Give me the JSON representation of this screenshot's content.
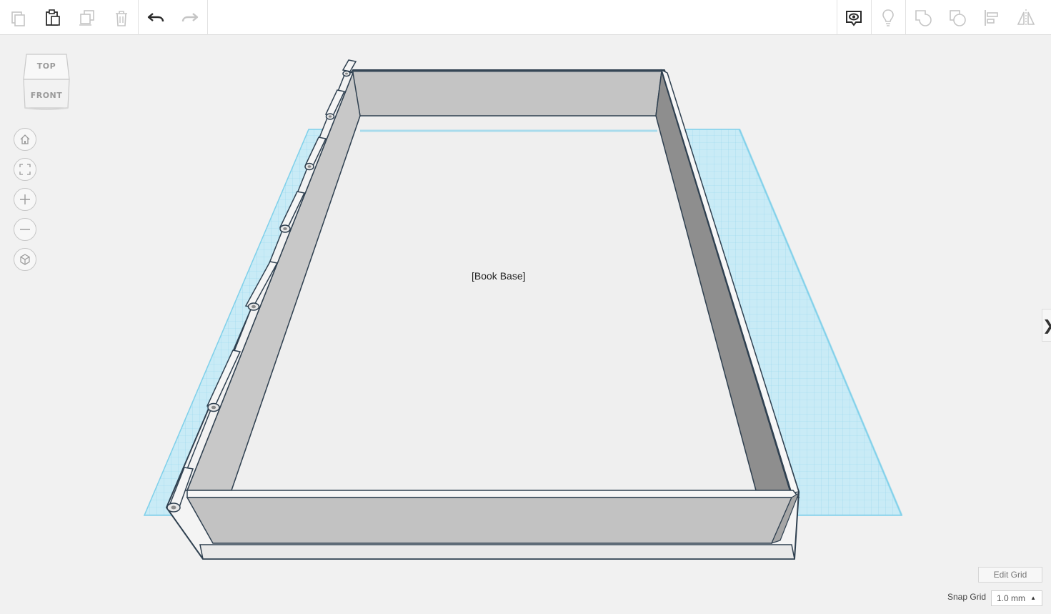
{
  "toolbar": {
    "left_buttons": [
      {
        "name": "copy",
        "icon": "copy-icon",
        "enabled": false
      },
      {
        "name": "paste",
        "icon": "paste-icon",
        "enabled": true
      },
      {
        "name": "duplicate",
        "icon": "duplicate-icon",
        "enabled": false
      },
      {
        "name": "delete",
        "icon": "trash-icon",
        "enabled": false
      },
      {
        "name": "undo",
        "icon": "undo-icon",
        "enabled": true
      },
      {
        "name": "redo",
        "icon": "redo-icon",
        "enabled": false
      }
    ],
    "right_buttons": [
      {
        "name": "show-all",
        "icon": "eye-bubble-icon",
        "enabled": true
      },
      {
        "name": "light",
        "icon": "lightbulb-icon",
        "enabled": false
      },
      {
        "name": "group",
        "icon": "group-icon",
        "enabled": false
      },
      {
        "name": "ungroup",
        "icon": "ungroup-icon",
        "enabled": false
      },
      {
        "name": "align",
        "icon": "align-icon",
        "enabled": false
      },
      {
        "name": "mirror",
        "icon": "mirror-icon",
        "enabled": false
      }
    ]
  },
  "viewcube": {
    "top_label": "TOP",
    "front_label": "FRONT"
  },
  "nav_controls": [
    {
      "name": "home-view",
      "icon": "home-icon"
    },
    {
      "name": "fit-view",
      "icon": "fit-view-icon"
    },
    {
      "name": "zoom-in",
      "icon": "plus-icon"
    },
    {
      "name": "zoom-out",
      "icon": "minus-icon"
    },
    {
      "name": "projection",
      "icon": "cube-icon"
    }
  ],
  "scene": {
    "object_label": "[Book Base]"
  },
  "side_panel": {
    "toggle_glyph": "❯"
  },
  "grid": {
    "edit_label": "Edit Grid",
    "snap_label": "Snap Grid",
    "snap_value": "1.0 mm",
    "snap_arrow": "▲"
  },
  "colors": {
    "grid_blue": "#7fd0ea",
    "object_light": "#efefef",
    "object_mid": "#c4c4c4",
    "object_dark": "#8e8e8e",
    "outline": "#2f4050",
    "icon_enabled": "#2a2a2a",
    "icon_disabled": "#c5c5c5"
  }
}
